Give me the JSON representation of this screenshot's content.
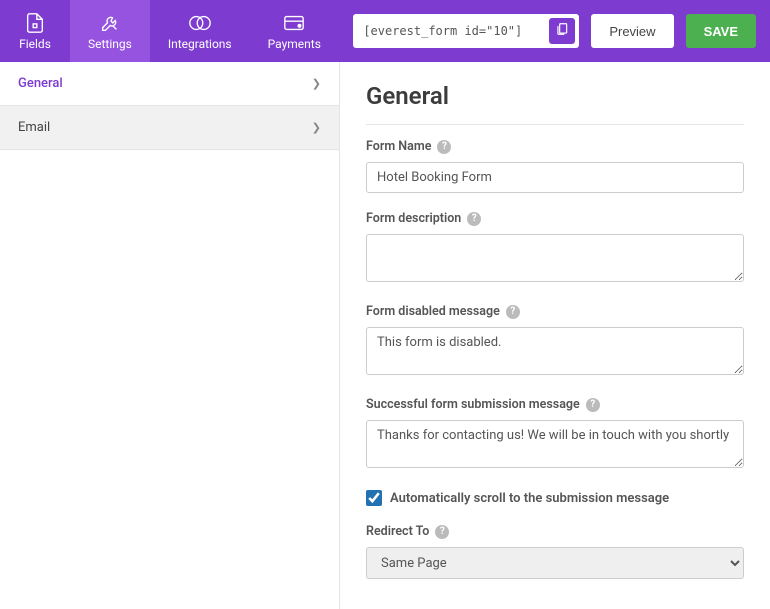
{
  "header": {
    "tabs": {
      "fields": "Fields",
      "settings": "Settings",
      "integrations": "Integrations",
      "payments": "Payments"
    },
    "shortcode": "[everest_form id=\"10\"]",
    "preview": "Preview",
    "save": "SAVE"
  },
  "sidebar": {
    "general": "General",
    "email": "Email"
  },
  "main": {
    "title": "General",
    "form_name_label": "Form Name",
    "form_name_value": "Hotel Booking Form",
    "form_description_label": "Form description",
    "form_description_value": "",
    "disabled_label": "Form disabled message",
    "disabled_value": "This form is disabled.",
    "success_label": "Successful form submission message",
    "success_value": "Thanks for contacting us! We will be in touch with you shortly",
    "auto_scroll_label": "Automatically scroll to the submission message",
    "redirect_label": "Redirect To",
    "redirect_value": "Same Page"
  }
}
